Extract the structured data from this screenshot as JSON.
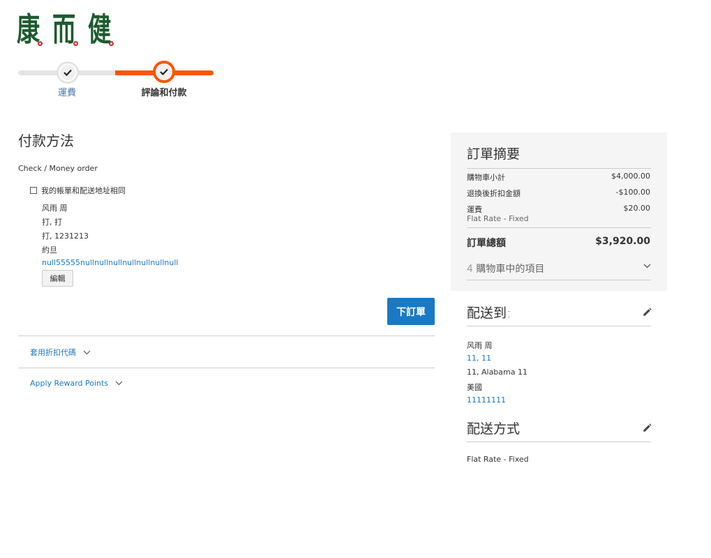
{
  "logo": {
    "chars": [
      "康",
      "而",
      "健"
    ]
  },
  "progress": {
    "steps": [
      {
        "label": "運費",
        "status": "complete"
      },
      {
        "label": "評論和付款",
        "status": "active"
      }
    ],
    "colors": {
      "active": "#ff5501",
      "inactive": "#e4e4e4"
    }
  },
  "payment": {
    "title": "付款方法",
    "method": "Check / Money order",
    "same_address_label": "我的帳單和配送地址相同",
    "same_address_checked": false,
    "billing_address": {
      "name": "风雨 周",
      "street": "打, 打",
      "city_line": "打, 1231213",
      "country": "約旦",
      "phone": "null55555nullnullnullnullnullnullnull"
    },
    "edit_label": "編輯",
    "place_order_label": "下訂單",
    "discount_toggle": "套用折扣代碼",
    "reward_toggle": "Apply Reward Points"
  },
  "summary": {
    "title": "訂單摘要",
    "rows": [
      {
        "label": "購物車小計",
        "value": "$4,000.00"
      },
      {
        "label": "退換後折扣金額",
        "value": "-$100.00"
      },
      {
        "label": "運費",
        "value": "$20.00",
        "sub": "Flat Rate - Fixed"
      }
    ],
    "total_label": "訂單總額",
    "total_value": "$3,920.00",
    "items_toggle": "4 購物車中的項目"
  },
  "ship_to": {
    "title": "配送到:",
    "name": "风雨 周",
    "street": "11, 11",
    "city_line": "11, Alabama 11",
    "country": "美國",
    "phone": "11111111"
  },
  "ship_method": {
    "title": "配送方式",
    "value": "Flat Rate - Fixed"
  },
  "colors": {
    "accent": "#1979c3",
    "progress": "#ff5501",
    "logo": "#1d5b2f",
    "logo_dot": "#d8262a"
  }
}
